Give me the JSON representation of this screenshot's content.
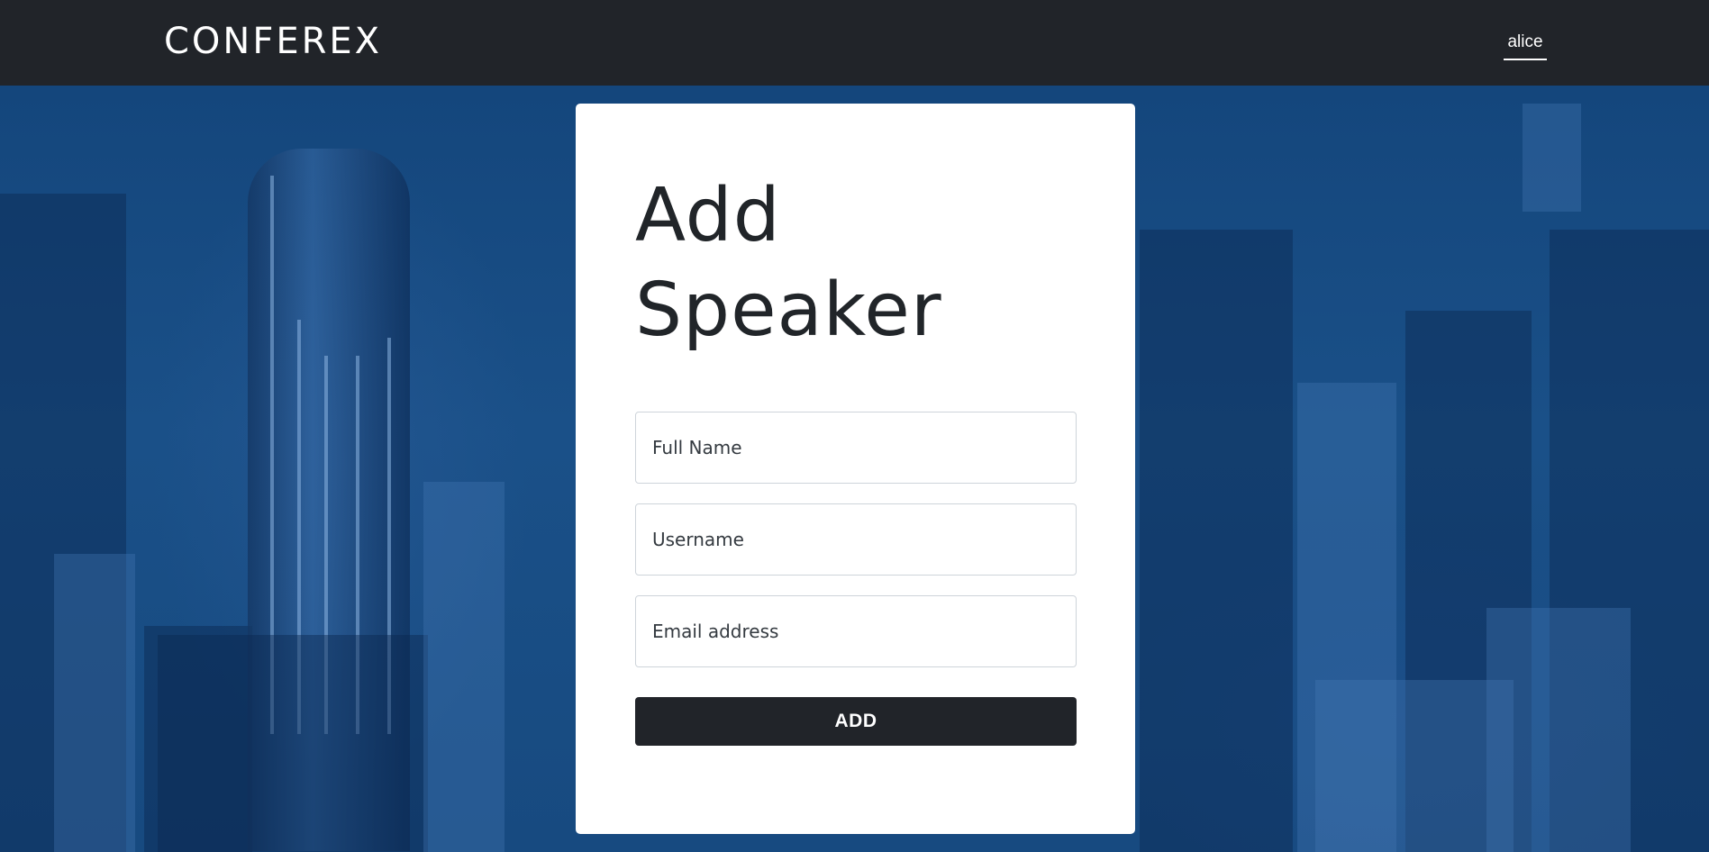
{
  "navbar": {
    "brand": "CONFEREX",
    "user": "alice"
  },
  "form": {
    "title": "Add Speaker",
    "full_name": {
      "placeholder": "Full Name",
      "value": ""
    },
    "username": {
      "placeholder": "Username",
      "value": ""
    },
    "email": {
      "placeholder": "Email address",
      "value": ""
    },
    "submit_label": "ADD"
  },
  "colors": {
    "navbar_bg": "#212429",
    "page_bg_blue": "#1b4f86",
    "card_bg": "#ffffff",
    "button_bg": "#212429",
    "button_text": "#ffffff"
  }
}
